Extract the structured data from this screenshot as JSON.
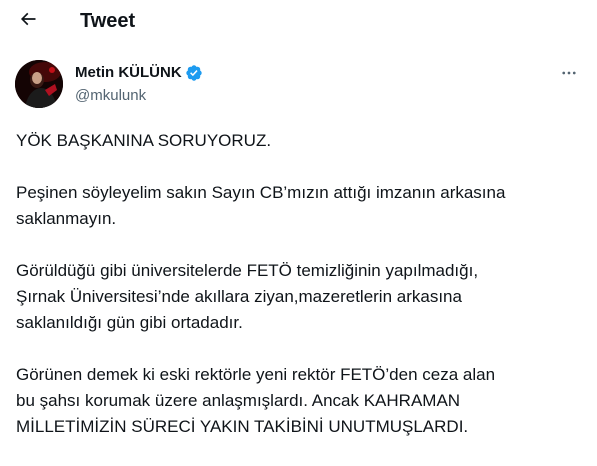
{
  "header": {
    "title": "Tweet",
    "back_icon": "arrow-left-icon"
  },
  "author": {
    "display_name": "Metin KÜLÜNK",
    "handle": "@mkulunk",
    "verified_icon": "verified-badge-icon",
    "verified_color": "#1d9bf0"
  },
  "more_icon": "ellipsis-icon",
  "tweet": {
    "paragraphs": [
      "YÖK BAŞKANINA SORUYORUZ.",
      "Peşinen söyleyelim sakın Sayın CB’mızın attığı imzanın arkasına\nsaklanmayın.",
      "Görüldüğü gibi üniversitelerde FETÖ temizliğinin yapılmadığı,\nŞırnak Üniversitesi’nde akıllara ziyan,mazeretlerin arkasına\nsaklanıldığı gün gibi ortadadır.",
      "Görünen demek ki eski rektörle yeni rektör FETÖ’den ceza alan\nbu şahsı korumak üzere anlaşmışlardı. Ancak KAHRAMAN\nMİLLETİMİZİN SÜRECİ YAKIN TAKİBİNİ UNUTMUŞLARDI."
    ]
  },
  "colors": {
    "text": "#0f1419",
    "secondary_text": "#536471",
    "background": "#ffffff"
  }
}
